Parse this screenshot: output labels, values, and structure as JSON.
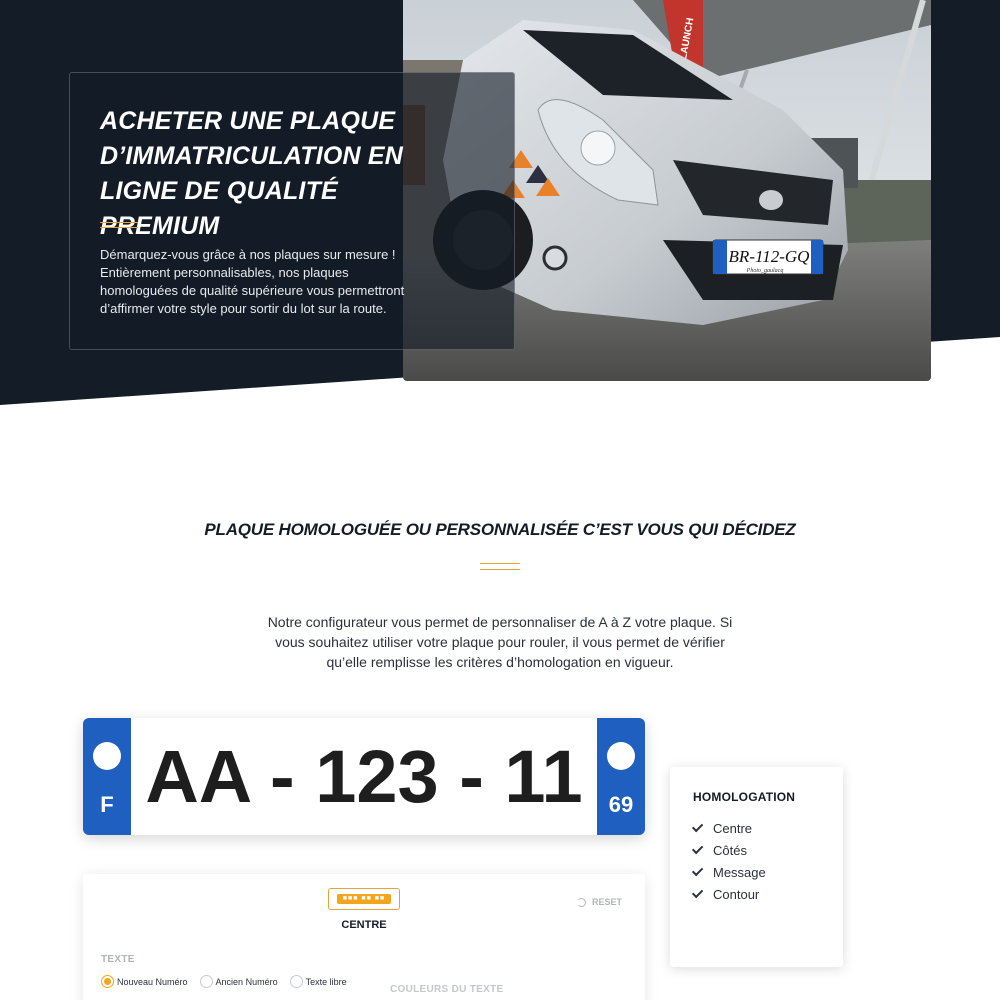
{
  "hero": {
    "title": "ACHETER UNE PLAQUE D’IMMATRICULATION EN LIGNE DE QUALITÉ PREMIUM",
    "text": "Démarquez-vous grâce à nos plaques sur mesure ! Entièrement personnalisables, nos plaques homologuées de qualité supérieure vous permettront d’affirmer votre style pour sortir du lot sur la route.",
    "photo_plate": "BR-112-GQ",
    "photo_caption": "Photo_gaulacq",
    "awning_text": "LAUNCH"
  },
  "section": {
    "title": "PLAQUE HOMOLOGUÉE OU PERSONNALISÉE C’EST VOUS QUI DÉCIDEZ",
    "text": "Notre configurateur vous permet de personnaliser de A à Z votre plaque. Si vous souhaitez utiliser votre plaque pour rouler, il vous permet de vérifier qu’elle remplisse les critères d’homologation en vigueur."
  },
  "plate": {
    "number": "AA - 123 - 11",
    "country": "F",
    "department": "69",
    "band_color": "#1f5fbf"
  },
  "homologation": {
    "title": "HOMOLOGATION",
    "items": [
      "Centre",
      "Côtés",
      "Message",
      "Contour"
    ]
  },
  "configurator": {
    "mini_plate": "■■■ ■■ ■■",
    "zone_label": "CENTRE",
    "reset_label": "RESET",
    "text_label": "TEXTE",
    "options": [
      "Nouveau Numéro",
      "Ancien Numéro",
      "Texte libre"
    ],
    "selected_option": "Nouveau Numéro",
    "colors_label": "COULEURS DU TEXTE"
  },
  "colors": {
    "navy": "#141c27",
    "accent": "#e8a23a",
    "radio_active": "#f3a51e"
  }
}
